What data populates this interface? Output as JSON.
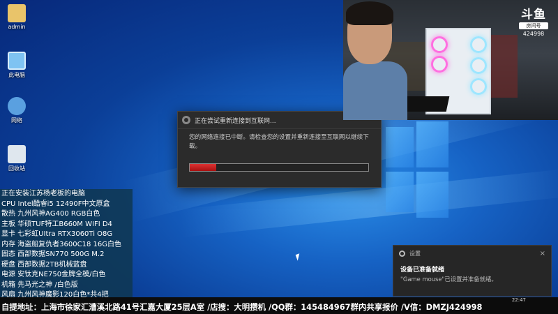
{
  "desktop": {
    "icons": [
      {
        "label": "admin",
        "icon": "user-folder-icon"
      },
      {
        "label": "此电脑",
        "icon": "computer-icon"
      },
      {
        "label": "网络",
        "icon": "network-icon"
      },
      {
        "label": "回收站",
        "icon": "recycle-bin-icon"
      }
    ]
  },
  "dialog": {
    "title": "正在尝试重新连接到互联网...",
    "message": "您的网络连接已中断。请检查您的设置并重新连接至互联网以继续下载。",
    "progress": 0.15,
    "accent_color": "#cc2222"
  },
  "stream": {
    "platform_logo": "斗鱼",
    "room_label": "房间号",
    "room_number": "424998"
  },
  "specs": {
    "header": "正在安装江苏杨老板的电脑",
    "lines": [
      "CPU Intel酷睿i5 12490F中文原盒",
      "散热 九州风神AG400 RGB白色",
      "主板 华硕TUF特工B660M WIFI D4",
      "显卡 七彩虹UItra RTX3060Ti O8G",
      "内存 海盗船复仇者3600C18 16G白色",
      "固态 西部数据SN770 500G M.2",
      "硬盘 西部数据2TB机械蓝盘",
      "电源 安钛克NE750金牌全模/白色",
      "机箱 先马光之神 /白色版",
      "风扇 九州风神魔影120白色*共4把"
    ]
  },
  "toast": {
    "app": "设置",
    "title": "设备已准备就绪",
    "message": "\"Game mouse\"已设置并准备就绪。",
    "close": "×"
  },
  "taskbar": {
    "clock": "22:47"
  },
  "ticker": "自提地址：上海市徐家汇漕溪北路41号汇嘉大厦25层A室 /店搜：大明攒机 /QQ群：145484967群内共享报价 /V信：DMZJ424998"
}
